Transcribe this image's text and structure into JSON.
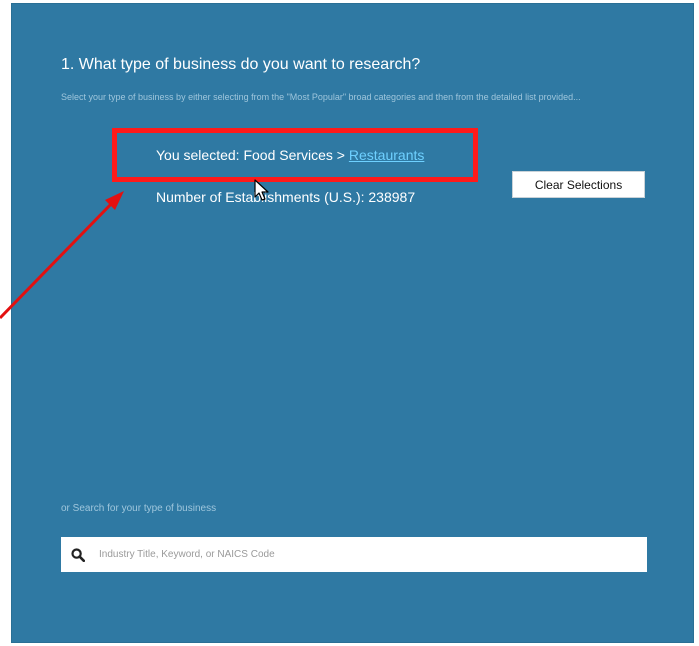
{
  "header": {
    "question": "1. What type of business do you want to research?",
    "instructions": "Select your type of business by either selecting from the \"Most Popular\" broad categories and then from the detailed list provided..."
  },
  "selection": {
    "prefix": "You selected: Food Services > ",
    "category_link": "Restaurants"
  },
  "establishments": {
    "label": "Number of Establishments (U.S.): 238987"
  },
  "actions": {
    "clear_label": "Clear Selections"
  },
  "search": {
    "label": "or Search for your type of business",
    "placeholder": "Industry Title, Keyword, or NAICS Code",
    "value": ""
  },
  "colors": {
    "panel": "#2f79a3",
    "highlight": "#ff1a1a",
    "link": "#6ed0ff"
  },
  "icons": [
    "search-icon",
    "annotation-arrow-icon",
    "mouse-cursor-icon"
  ]
}
